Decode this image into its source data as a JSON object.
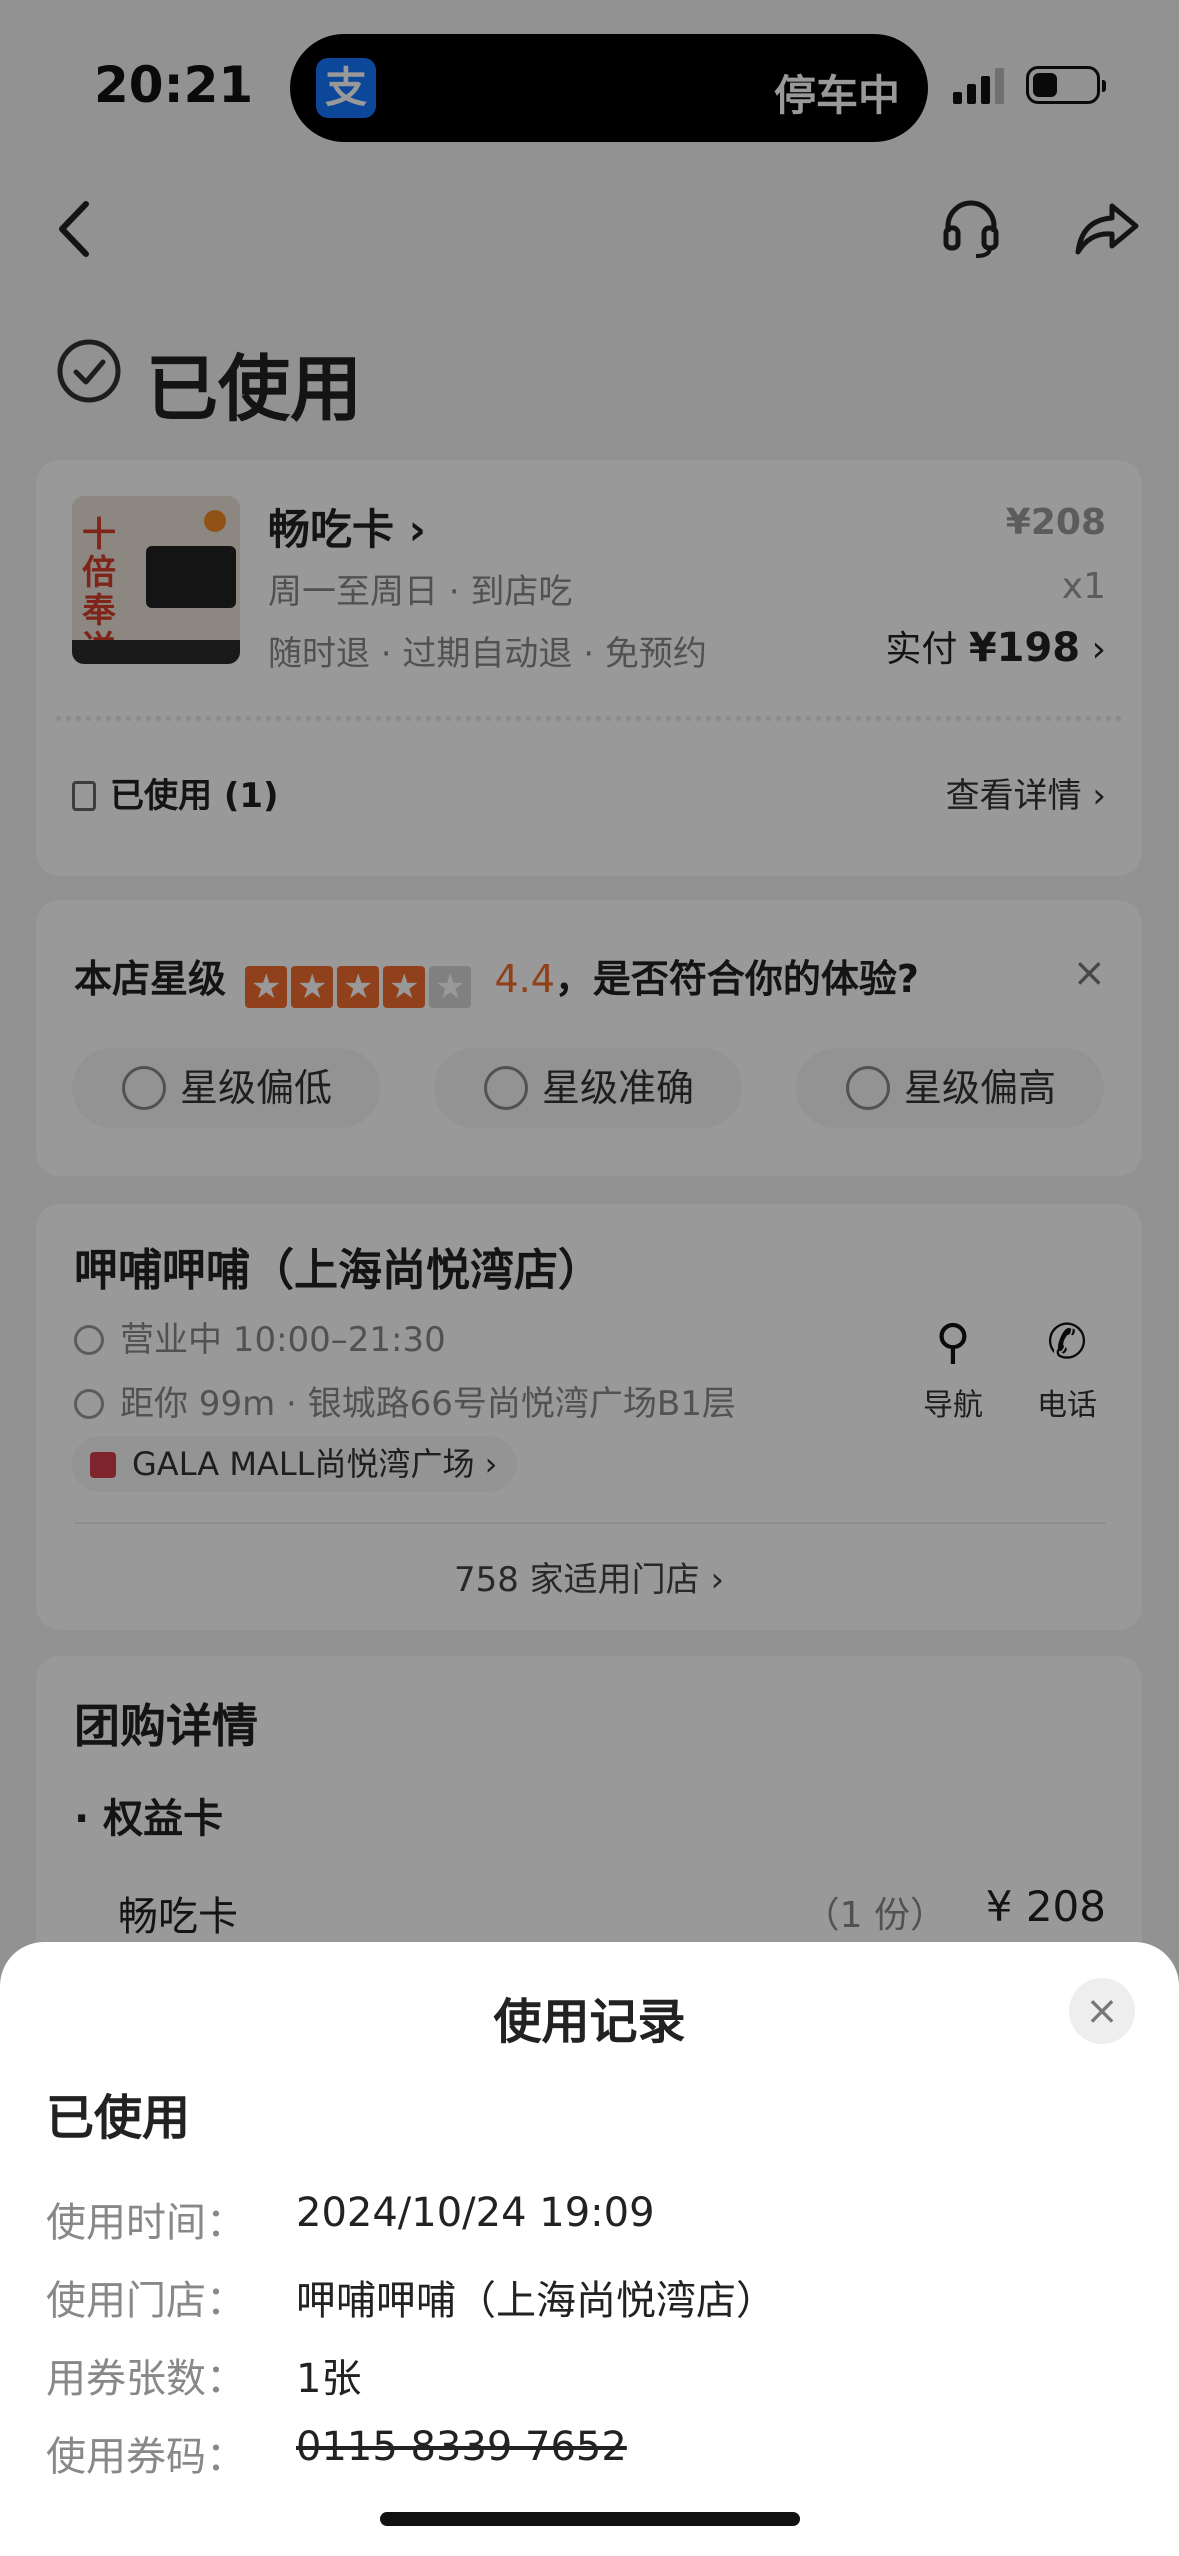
{
  "status_bar": {
    "time": "20:21",
    "island_icon": "支",
    "island_text": "停车中",
    "battery_level": 0.4
  },
  "page": {
    "title": "已使用"
  },
  "product": {
    "name": "畅吃卡",
    "line1": "周一至周日 · 到店吃",
    "line2": "随时退 · 过期自动退 · 免预约",
    "original_price": "¥208",
    "quantity": "x1",
    "paid_label": "实付",
    "paid_amount": "¥198",
    "image_text": "十倍奉送",
    "used_label": "已使用 (1)",
    "detail_link": "查看详情"
  },
  "rating": {
    "prefix": "本店星级",
    "stars": 4,
    "score": "4.4",
    "question": "，是否符合你的体验?",
    "close": "×",
    "options": [
      "星级偏低",
      "星级准确",
      "星级偏高"
    ]
  },
  "store": {
    "name": "呷哺呷哺（上海尚悦湾店）",
    "hours": "营业中 10:00–21:30",
    "address": "距你 99m · 银城路66号尚悦湾广场B1层",
    "mall": "GALA MALL尚悦湾广场",
    "nav_label": "导航",
    "phone_label": "电话",
    "stores_count": "758 家适用门店"
  },
  "group_details": {
    "title": "团购详情",
    "section": "权益卡",
    "item": "畅吃卡",
    "count": "（1 份）",
    "price": "¥ 208"
  },
  "sheet": {
    "title": "使用记录",
    "close": "×",
    "status": "已使用",
    "rows": [
      {
        "label": "使用时间：",
        "value": "2024/10/24 19:09"
      },
      {
        "label": "使用门店：",
        "value": "呷哺呷哺（上海尚悦湾店）"
      },
      {
        "label": "用券张数：",
        "value": "1张"
      },
      {
        "label": "使用券码：",
        "value": "0115 8339 7652"
      }
    ]
  }
}
